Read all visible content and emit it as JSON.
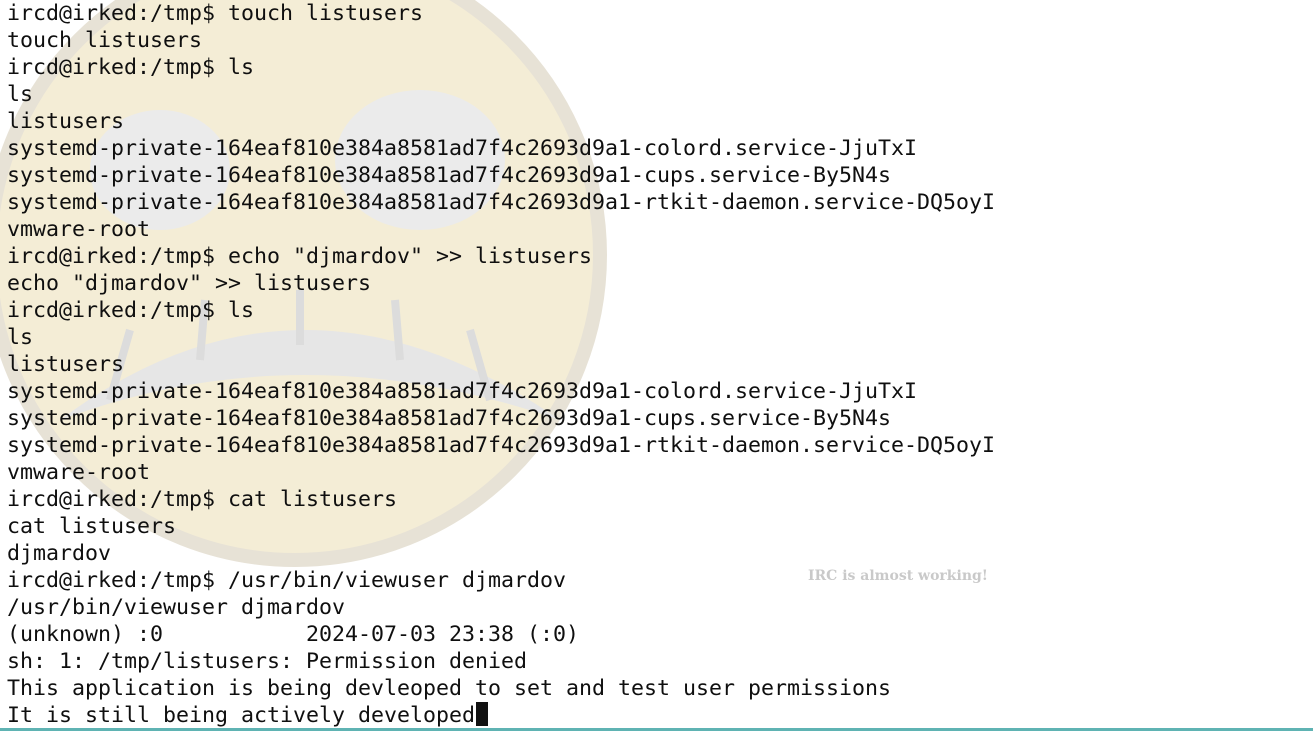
{
  "terminal": {
    "lines": [
      "ircd@irked:/tmp$ touch listusers",
      "touch listusers",
      "ircd@irked:/tmp$ ls",
      "ls",
      "listusers",
      "systemd-private-164eaf810e384a8581ad7f4c2693d9a1-colord.service-JjuTxI",
      "systemd-private-164eaf810e384a8581ad7f4c2693d9a1-cups.service-By5N4s",
      "systemd-private-164eaf810e384a8581ad7f4c2693d9a1-rtkit-daemon.service-DQ5oyI",
      "vmware-root",
      "ircd@irked:/tmp$ echo \"djmardov\" >> listusers",
      "echo \"djmardov\" >> listusers",
      "ircd@irked:/tmp$ ls",
      "ls",
      "listusers",
      "systemd-private-164eaf810e384a8581ad7f4c2693d9a1-colord.service-JjuTxI",
      "systemd-private-164eaf810e384a8581ad7f4c2693d9a1-cups.service-By5N4s",
      "systemd-private-164eaf810e384a8581ad7f4c2693d9a1-rtkit-daemon.service-DQ5oyI",
      "vmware-root",
      "ircd@irked:/tmp$ cat listusers",
      "cat listusers",
      "djmardov",
      "ircd@irked:/tmp$ /usr/bin/viewuser djmardov",
      "/usr/bin/viewuser djmardov",
      "(unknown) :0           2024-07-03 23:38 (:0)",
      "sh: 1: /tmp/listusers: Permission denied",
      "This application is being devleoped to set and test user permissions",
      "It is still being actively developed"
    ],
    "watermark_caption": "IRC is almost working!",
    "colors": {
      "background": "#ffffff",
      "text": "#0f0f0f",
      "cursor": "#111111",
      "accent_bar": "#5fb3b3",
      "watermark_face": "#efe4c0"
    }
  }
}
